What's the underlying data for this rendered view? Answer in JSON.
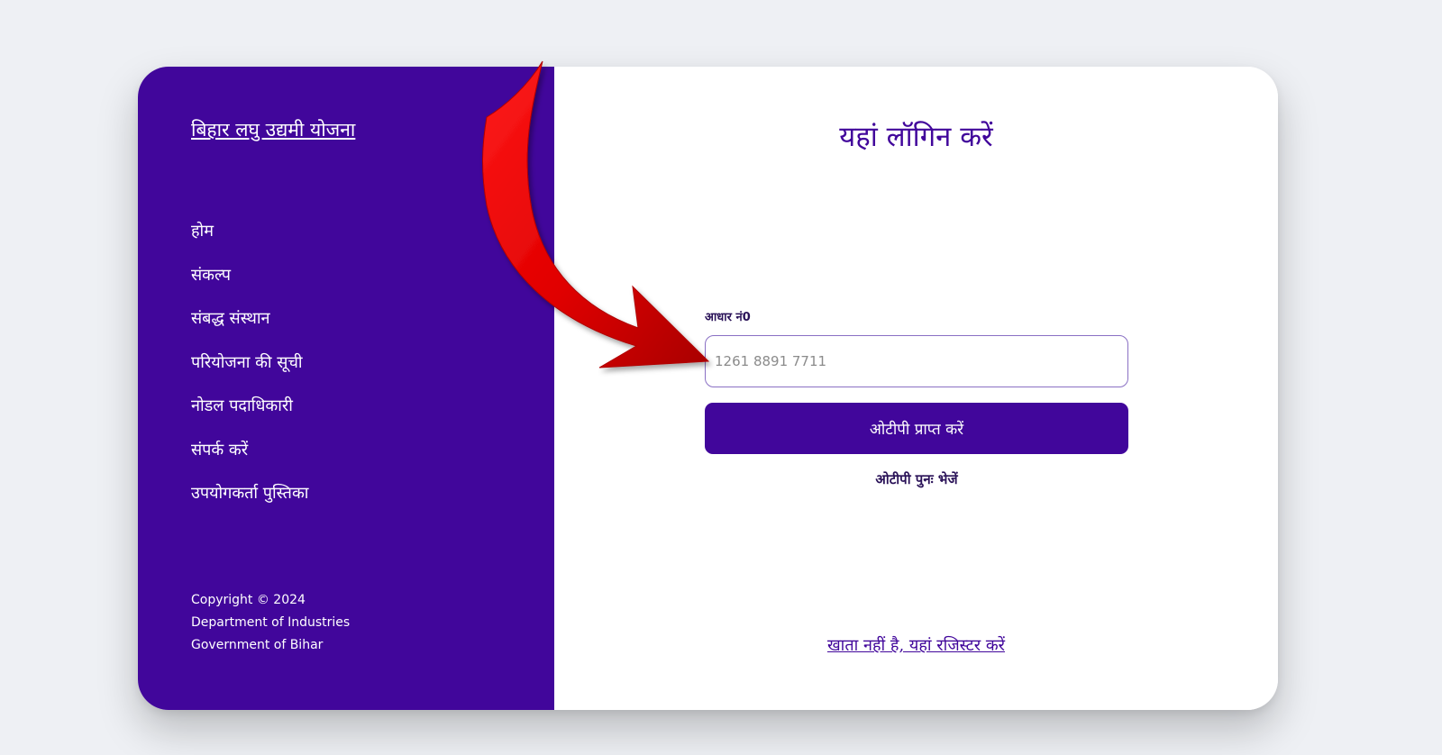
{
  "sidebar": {
    "brand": "बिहार लघु उद्यमी योजना",
    "nav_items": [
      {
        "label": "होम"
      },
      {
        "label": "संकल्प"
      },
      {
        "label": "संबद्ध संस्थान"
      },
      {
        "label": "परियोजना की सूची"
      },
      {
        "label": "नोडल पदाधिकारी"
      },
      {
        "label": "संपर्क करें"
      },
      {
        "label": "उपयोगकर्ता पुस्तिका"
      }
    ],
    "copyright_lines": [
      "Copyright © 2024",
      "Department of Industries",
      "Government of Bihar"
    ]
  },
  "login": {
    "title": "यहां लॉगिन करें",
    "aadhaar_label": "आधार नं0",
    "aadhaar_value": "",
    "aadhaar_placeholder": "1261 8891 7711",
    "otp_button": "ओटीपी प्राप्त करें",
    "resend_otp": "ओटीपी पुनः भेजें",
    "register_link": "खाता नहीं है, यहां रजिस्टर करें"
  },
  "annotation": {
    "icon": "red-pointer-arrow-icon",
    "color": "#e00000"
  },
  "colors": {
    "brand_purple": "#41069b",
    "background": "#eef0f4",
    "card": "#ffffff"
  }
}
